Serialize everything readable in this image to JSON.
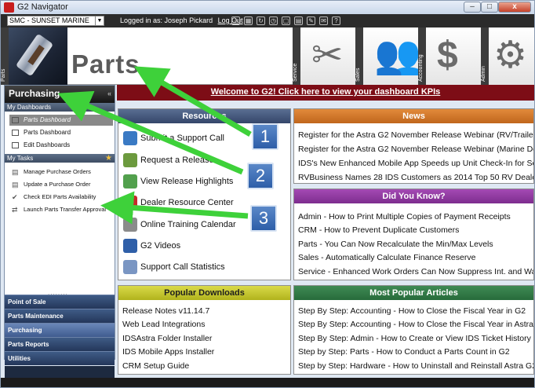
{
  "window": {
    "title": "G2 Navigator",
    "min": "–",
    "max": "□",
    "close": "x"
  },
  "topbar": {
    "store": "SMC - SUNSET MARINE",
    "logged_in": "Logged in as: Joseph Pickard",
    "logout": "Log Out"
  },
  "header": {
    "active_module": "Parts",
    "tabs": [
      "Parts",
      "Service",
      "Sales",
      "Accounting",
      "Admin"
    ],
    "page_title": "Parts"
  },
  "banner": {
    "text": "Welcome to G2!   Click here to view your dashboard KPIs"
  },
  "sidebar": {
    "title": "Purchasing",
    "collapse": "«",
    "dashboards_header": "My Dashboards",
    "dashboards": [
      "Parts Dashboard",
      "Parts Dashboard",
      "Edit Dashboards"
    ],
    "tasks_header": "My Tasks",
    "tasks": [
      "Manage Purchase Orders",
      "Update a Purchase Order",
      "Check EDI Parts Availability",
      "Launch Parts Transfer Approval"
    ],
    "grip": "........",
    "nav": [
      "Point of Sale",
      "Parts Maintenance",
      "Purchasing",
      "Parts Reports",
      "Utilities"
    ]
  },
  "resources": {
    "header": "Resources",
    "items": [
      "Submit a Support Call",
      "Request a Release",
      "View Release Highlights",
      "Dealer Resource Center",
      "Online Training Calendar",
      "G2 Videos",
      "Support Call Statistics"
    ]
  },
  "news": {
    "header": "News",
    "items": [
      "Register for the Astra G2 November Release Webinar (RV/Trailer",
      "Register for the Astra G2 November Release Webinar (Marine De",
      "IDS's New Enhanced Mobile App Speeds up Unit Check-In for Se",
      "RVBusiness Names 28 IDS Customers as 2014 Top 50 RV Deale"
    ]
  },
  "did_you_know": {
    "header": "Did You Know?",
    "items": [
      "Admin - How to Print Multiple Copies of Payment Receipts",
      "CRM - How to Prevent Duplicate Customers",
      "Parts - You Can Now Recalculate the Min/Max Levels",
      "Sales - Automatically Calculate Finance Reserve",
      "Service - Enhanced Work Orders Can Now Suppress Int. and War"
    ]
  },
  "popular_downloads": {
    "header": "Popular Downloads",
    "items": [
      "Release Notes v11.14.7",
      "Web Lead Integrations",
      "IDSAstra Folder Installer",
      "IDS Mobile Apps Installer",
      "CRM Setup Guide"
    ]
  },
  "popular_articles": {
    "header": "Most Popular Articles",
    "items": [
      "Step By Step: Accounting - How to Close the Fiscal Year in G2",
      "Step By Step: Accounting - How to Close the Fiscal Year in Astra",
      "Step By Step: Admin - How to Create or View IDS Ticket History",
      "Step by Step: Parts - How to Conduct a Parts Count in G2",
      "Step by Step: Hardware - How to Uninstall and Reinstall Astra G2"
    ]
  },
  "callouts": [
    "1",
    "2",
    "3"
  ],
  "colors": {
    "banner": "#7d0d16",
    "arrow": "#3ed13a",
    "callout": "#3b6fb8"
  }
}
